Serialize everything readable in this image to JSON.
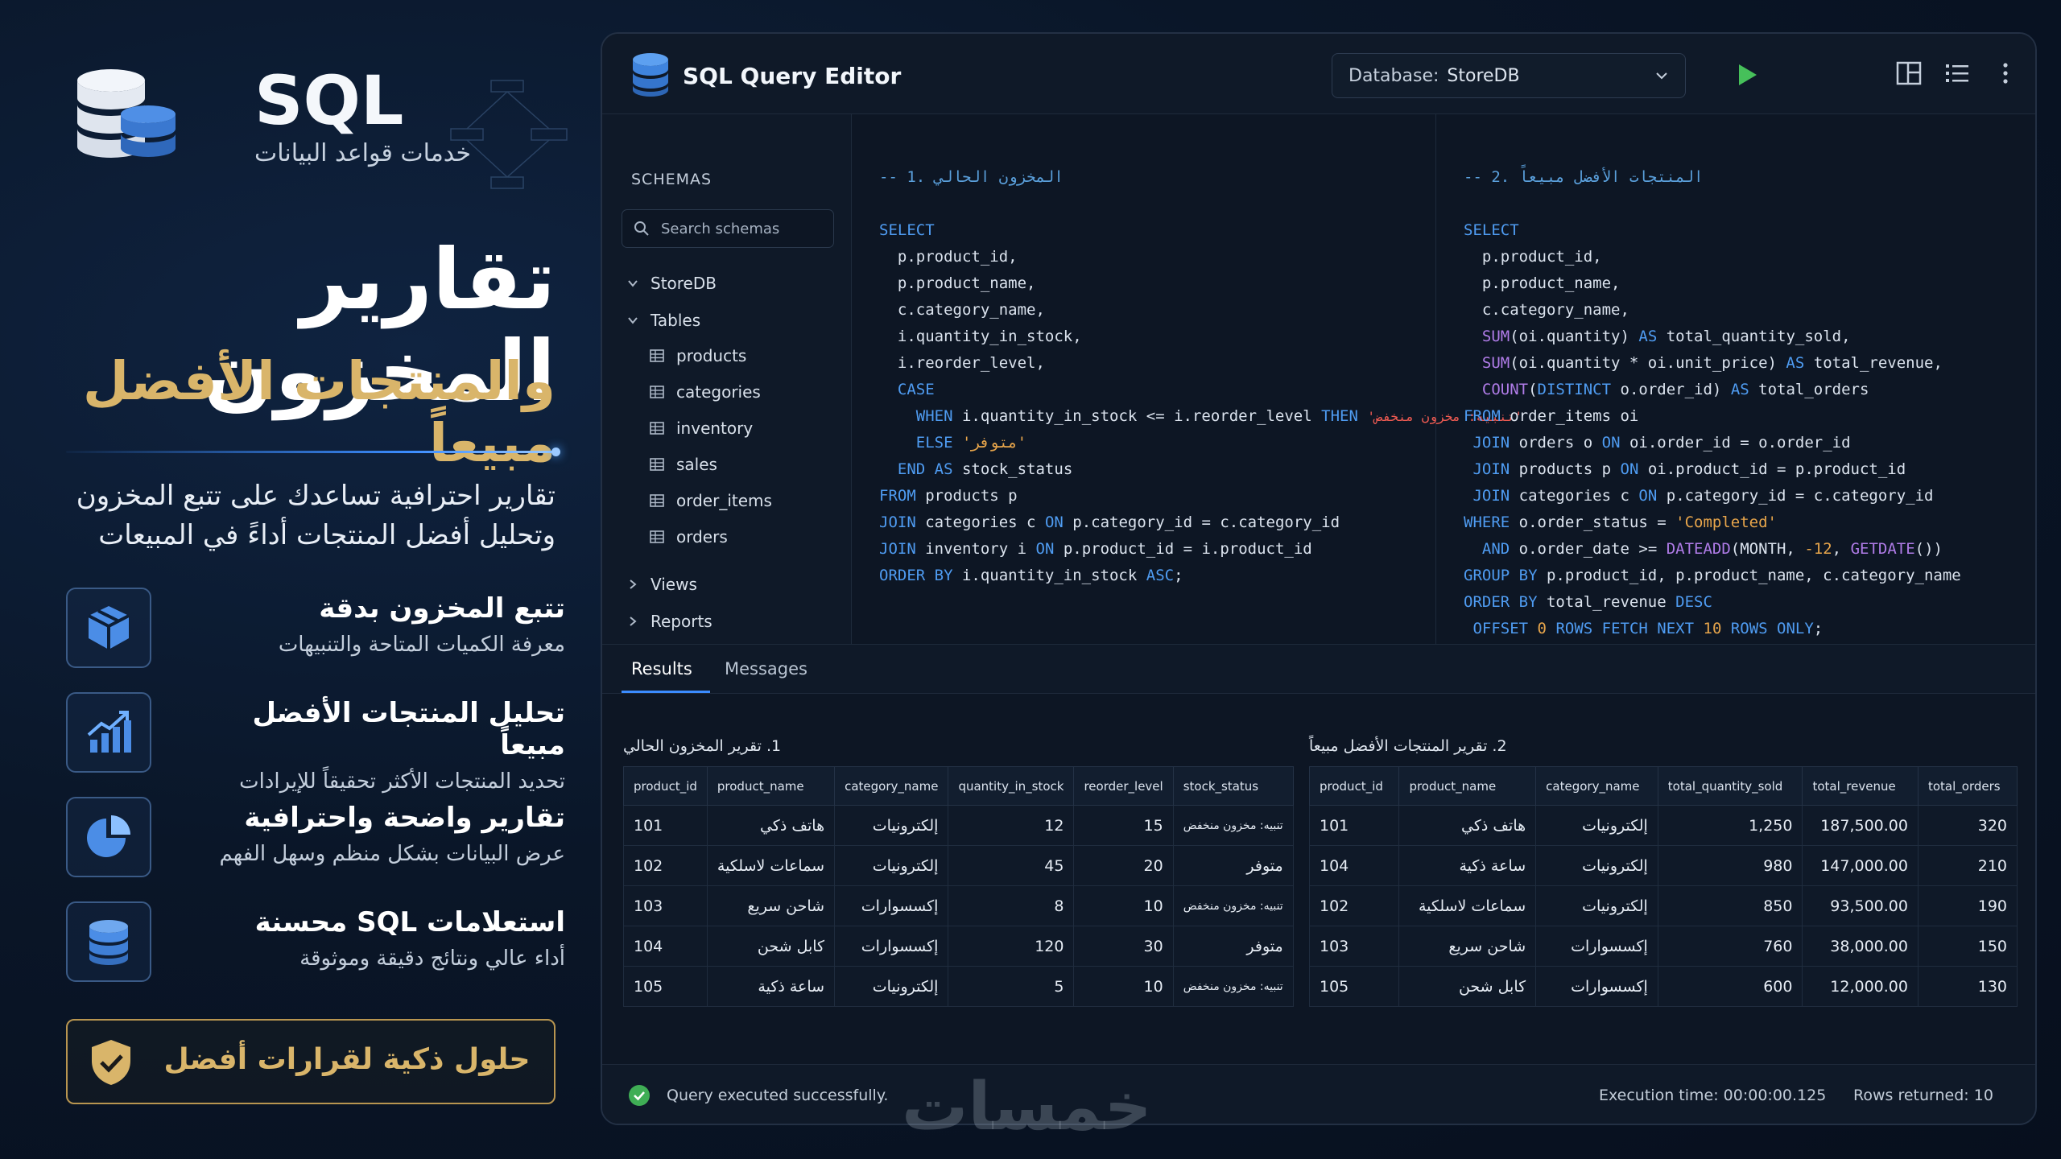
{
  "brand": {
    "title": "SQL",
    "subtitle": "خدمات قواعد البيانات"
  },
  "hero": {
    "title": "تقارير المخزون",
    "subtitle": "والمنتجات الأفضل مبيعاً",
    "lead": "تقارير احترافية تساعدك على تتبع المخزون وتحليل أفضل المنتجات أداءً في المبيعات"
  },
  "features": [
    {
      "icon": "box-icon",
      "title": "تتبع المخزون بدقة",
      "subtitle": "معرفة الكميات المتاحة والتنبيهات"
    },
    {
      "icon": "growth-chart-icon",
      "title": "تحليل المنتجات الأفضل مبيعاً",
      "subtitle": "تحديد المنتجات الأكثر تحقيقاً للإيرادات"
    },
    {
      "icon": "pie-chart-icon",
      "title": "تقارير واضحة واحترافية",
      "subtitle": "عرض البيانات بشكل منظم وسهل الفهم"
    },
    {
      "icon": "database-icon",
      "title": "استعلامات SQL محسنة",
      "subtitle": "أداء عالي ونتائج دقيقة وموثوقة"
    }
  ],
  "cta": {
    "icon": "shield-check-icon",
    "label": "حلول ذكية لقرارات أفضل"
  },
  "editor": {
    "title": "SQL Query Editor",
    "database_label": "Database:",
    "database_value": "StoreDB",
    "run_icon": "play-icon",
    "toolbar_icons": [
      "layout-icon",
      "list-icon",
      "more-vertical-icon"
    ]
  },
  "sidebar": {
    "heading": "SCHEMAS",
    "search_placeholder": "Search schemas",
    "db_node": "StoreDB",
    "tables_node": "Tables",
    "tables": [
      "products",
      "categories",
      "inventory",
      "sales",
      "order_items",
      "orders"
    ],
    "views_node": "Views",
    "reports_node": "Reports"
  },
  "query1": {
    "comment": "-- 1. المخزون الحالي",
    "warn_string": "'تنبيه: مخزون منخفض'",
    "ok_string": "'متوفر'"
  },
  "query2": {
    "comment": "-- 2. المنتجات الأفضل مبيعاً",
    "status_string": "'Completed'"
  },
  "tabs": {
    "results": "Results",
    "messages": "Messages"
  },
  "inventory_report": {
    "title": "1. تقرير المخزون الحالي",
    "columns": [
      "product_id",
      "product_name",
      "category_name",
      "quantity_in_stock",
      "reorder_level",
      "stock_status"
    ],
    "rows": [
      [
        "101",
        "هاتف ذكي",
        "إلكترونيات",
        "12",
        "15",
        "تنبيه: مخزون منخفض"
      ],
      [
        "102",
        "سماعات لاسلكية",
        "إلكترونيات",
        "45",
        "20",
        "متوفر"
      ],
      [
        "103",
        "شاحن سريع",
        "إكسسوارات",
        "8",
        "10",
        "تنبيه: مخزون منخفض"
      ],
      [
        "104",
        "كابل شحن",
        "إكسسوارات",
        "120",
        "30",
        "متوفر"
      ],
      [
        "105",
        "ساعة ذكية",
        "إلكترونيات",
        "5",
        "10",
        "تنبيه: مخزون منخفض"
      ]
    ]
  },
  "top_products_report": {
    "title": "2. تقرير المنتجات الأفضل مبيعاً",
    "columns": [
      "product_id",
      "product_name",
      "category_name",
      "total_quantity_sold",
      "total_revenue",
      "total_orders"
    ],
    "rows": [
      [
        "101",
        "هاتف ذكي",
        "إلكترونيات",
        "1,250",
        "187,500.00",
        "320"
      ],
      [
        "104",
        "ساعة ذكية",
        "إلكترونيات",
        "980",
        "147,000.00",
        "210"
      ],
      [
        "102",
        "سماعات لاسلكية",
        "إلكترونيات",
        "850",
        "93,500.00",
        "190"
      ],
      [
        "103",
        "شاحن سريع",
        "إكسسوارات",
        "760",
        "38,000.00",
        "150"
      ],
      [
        "105",
        "كابل شحن",
        "إكسسوارات",
        "600",
        "12,000.00",
        "130"
      ]
    ]
  },
  "status": {
    "message": "Query executed successfully.",
    "exec_label": "Execution time:",
    "exec_value": "00:00:00.125",
    "rows_label": "Rows returned:",
    "rows_value": "10"
  },
  "watermark": "خمسات",
  "colors": {
    "accent_blue": "#3b8cff",
    "gold": "#d9b56a",
    "warn": "#ef5b52",
    "ok": "#5ec46e",
    "background": "#0a1628"
  }
}
